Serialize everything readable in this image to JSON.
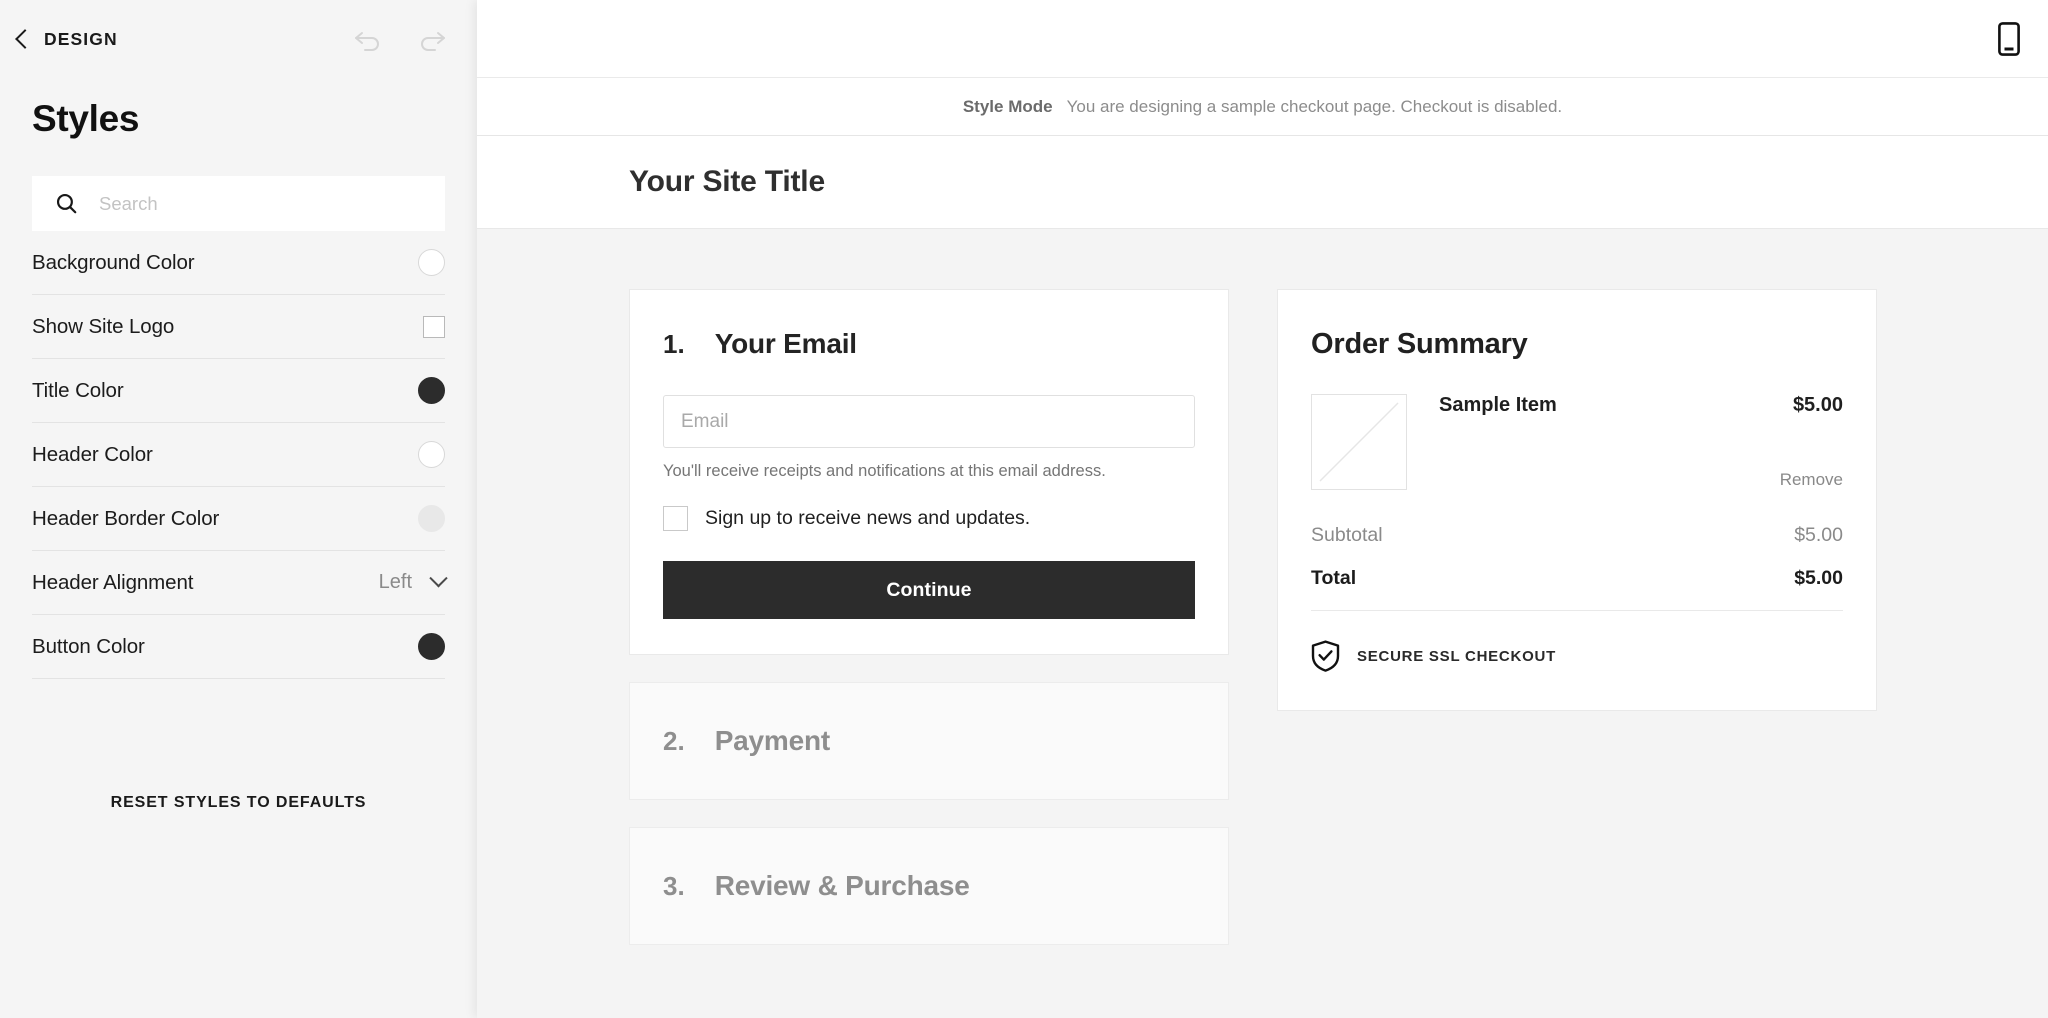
{
  "sidebar": {
    "back_label": "DESIGN",
    "back_icon": "chevron-left-icon",
    "undo_icon": "undo-icon",
    "redo_icon": "redo-icon",
    "panel_title": "Styles",
    "search": {
      "icon": "search-icon",
      "placeholder": "Search",
      "value": ""
    },
    "styles": [
      {
        "label": "Background Color",
        "control": "color",
        "color": "#ffffff"
      },
      {
        "label": "Show Site Logo",
        "control": "checkbox",
        "checked": false
      },
      {
        "label": "Title Color",
        "control": "color",
        "color": "#2c2c2c"
      },
      {
        "label": "Header Color",
        "control": "color",
        "color": "#ffffff"
      },
      {
        "label": "Header Border Color",
        "control": "color",
        "color": "#e8e8e8"
      },
      {
        "label": "Header Alignment",
        "control": "select",
        "value": "Left"
      },
      {
        "label": "Button Color",
        "control": "color",
        "color": "#2c2c2c"
      }
    ],
    "reset_label": "RESET STYLES TO DEFAULTS"
  },
  "preview": {
    "toolbar": {
      "device_icon": "mobile-device-icon"
    },
    "banner": {
      "strong": "Style Mode",
      "text": "You are designing a sample checkout page. Checkout is disabled."
    },
    "site_title": "Your Site Title",
    "steps": [
      {
        "num": "1.",
        "title": "Your Email",
        "state": "active"
      },
      {
        "num": "2.",
        "title": "Payment",
        "state": "collapsed"
      },
      {
        "num": "3.",
        "title": "Review & Purchase",
        "state": "collapsed"
      }
    ],
    "email_step": {
      "input_placeholder": "Email",
      "input_value": "",
      "helper": "You'll receive receipts and notifications at this email address.",
      "signup_label": "Sign up to receive news and updates.",
      "signup_checked": false,
      "continue_label": "Continue"
    },
    "order_summary": {
      "title": "Order Summary",
      "thumb_icon": "image-placeholder-icon",
      "item_name": "Sample Item",
      "item_price": "$5.00",
      "remove_label": "Remove",
      "rows": [
        {
          "label": "Subtotal",
          "value": "$5.00",
          "strong": false
        },
        {
          "label": "Total",
          "value": "$5.00",
          "strong": true
        }
      ],
      "ssl_icon": "shield-check-icon",
      "ssl_text": "SECURE SSL CHECKOUT"
    }
  }
}
